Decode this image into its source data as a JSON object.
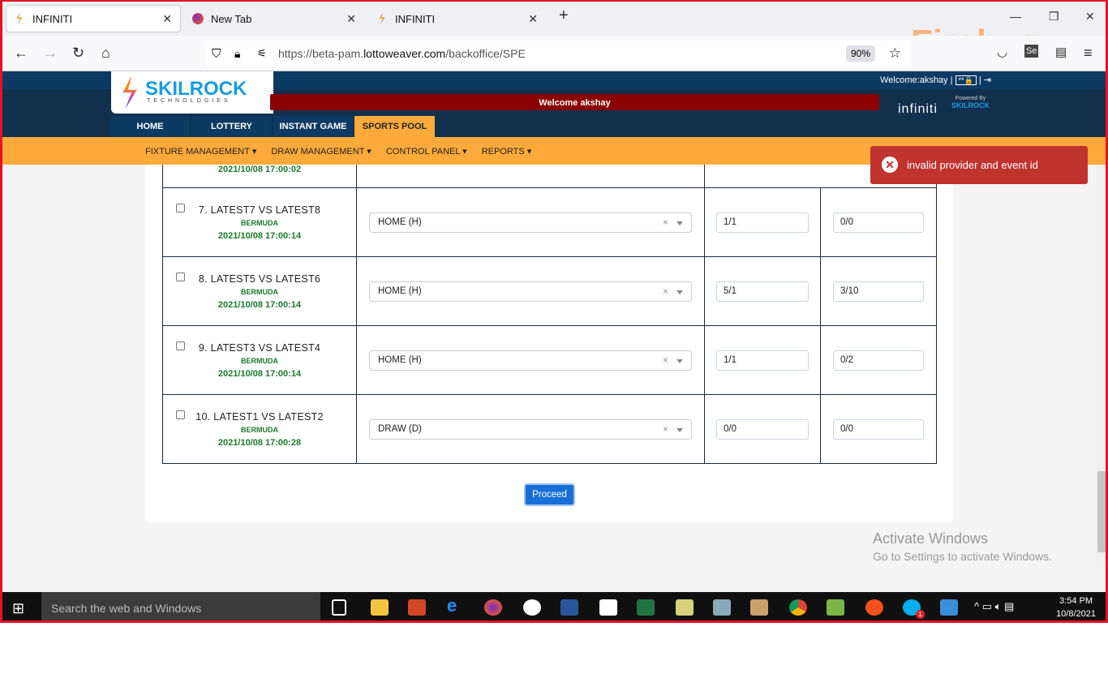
{
  "browser": {
    "tabs": [
      {
        "title": "INFINITI",
        "active": true
      },
      {
        "title": "New Tab",
        "active": false
      },
      {
        "title": "INFINITI",
        "active": false
      }
    ],
    "url_prefix": "https://beta-pam.",
    "url_domain": "lottoweaver.com",
    "url_path": "/backoffice/SPE",
    "zoom": "90%",
    "overlay": "Firebug"
  },
  "header": {
    "logo_name": "SKILROCK",
    "logo_sub": "TECHNOLOGIES",
    "banner": "Welcome akshay",
    "welcome": "Welcome:akshay",
    "password_badge": "**🔒",
    "brand": "infiniti",
    "powered_by": "Powered By",
    "powered_brand": "SKILROCK",
    "menu": [
      {
        "label": "HOME"
      },
      {
        "label": "LOTTERY"
      },
      {
        "label": "INSTANT GAME"
      },
      {
        "label": "SPORTS POOL",
        "active": true
      }
    ],
    "submenu": [
      "FIXTURE MANAGEMENT",
      "DRAW MANAGEMENT",
      "CONTROL PANEL",
      "REPORTS"
    ]
  },
  "table": {
    "partial_row_date": "2021/10/08 17:00:02",
    "rows": [
      {
        "match": "7. LATEST7 VS LATEST8",
        "location": "BERMUDA",
        "date": "2021/10/08 17:00:14",
        "result": "HOME (H)",
        "score1": "1/1",
        "score2": "0/0",
        "checked": false
      },
      {
        "match": "8. LATEST5 VS LATEST6",
        "location": "BERMUDA",
        "date": "2021/10/08 17:00:14",
        "result": "HOME (H)",
        "score1": "5/1",
        "score2": "3/10",
        "checked": false
      },
      {
        "match": "9. LATEST3 VS LATEST4",
        "location": "BERMUDA",
        "date": "2021/10/08 17:00:14",
        "result": "HOME (H)",
        "score1": "1/1",
        "score2": "0/2",
        "checked": false
      },
      {
        "match": "10. LATEST1 VS LATEST2",
        "location": "BERMUDA",
        "date": "2021/10/08 17:00:28",
        "result": "DRAW (D)",
        "score1": "0/0",
        "score2": "0/0",
        "checked": false
      }
    ]
  },
  "proceed_label": "Proceed",
  "toast": {
    "message": "invalid provider and event id",
    "color": "#c0332f"
  },
  "watermark": {
    "line1": "Activate Windows",
    "line2": "Go to Settings to activate Windows."
  },
  "taskbar": {
    "search_placeholder": "Search the web and Windows",
    "time": "3:54 PM",
    "date": "10/8/2021",
    "skype_badge": "1"
  },
  "colors": {
    "header": "#10304e",
    "accent": "#ffaa3b",
    "banner": "#8b0000",
    "green_text": "#1a7a2a",
    "button": "#1a6fd6"
  }
}
